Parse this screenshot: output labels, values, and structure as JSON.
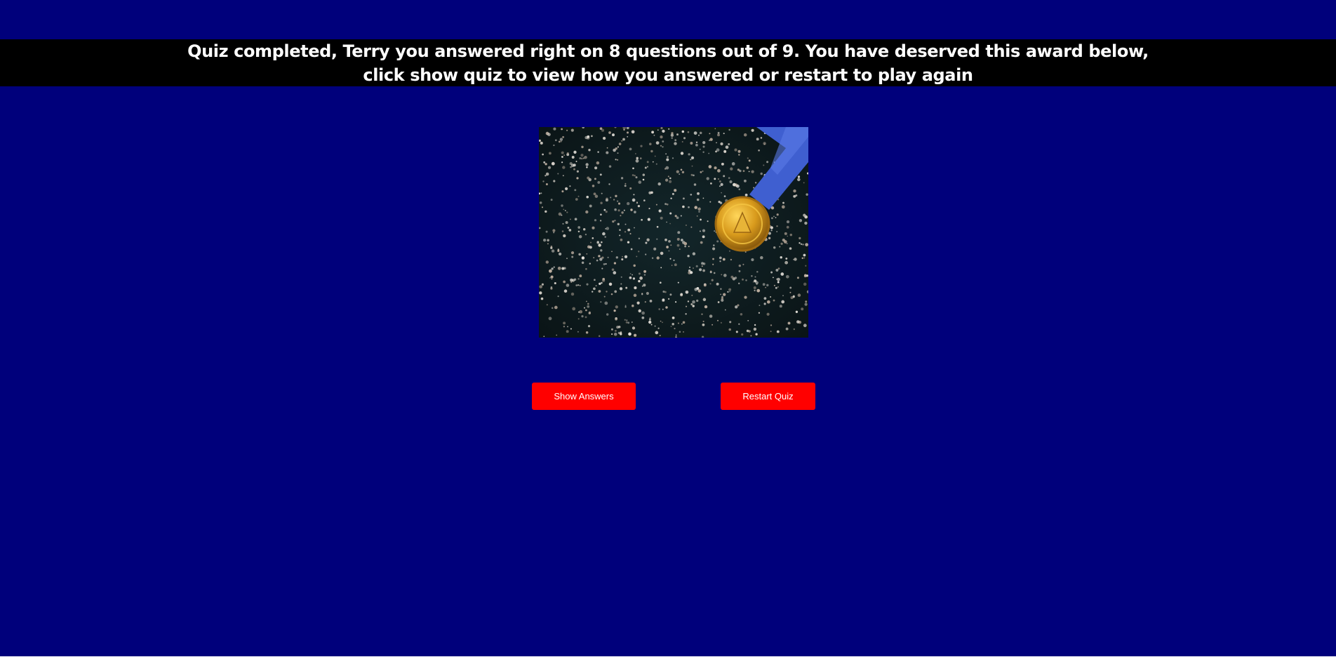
{
  "header": {
    "message_line1": "Quiz completed, Terry you answered right on 8 questions out of 9. You have deserved this award below,",
    "message_line2": "click show quiz to view how you answered or restart to play again"
  },
  "award": {
    "image_icon": "gold-medal-with-blue-ribbon-on-confetti"
  },
  "actions": {
    "show_answers_label": "Show Answers",
    "restart_quiz_label": "Restart Quiz"
  },
  "colors": {
    "page_background": "#00007b",
    "banner_background": "#000000",
    "button_background": "#ff0000",
    "text": "#ffffff"
  }
}
